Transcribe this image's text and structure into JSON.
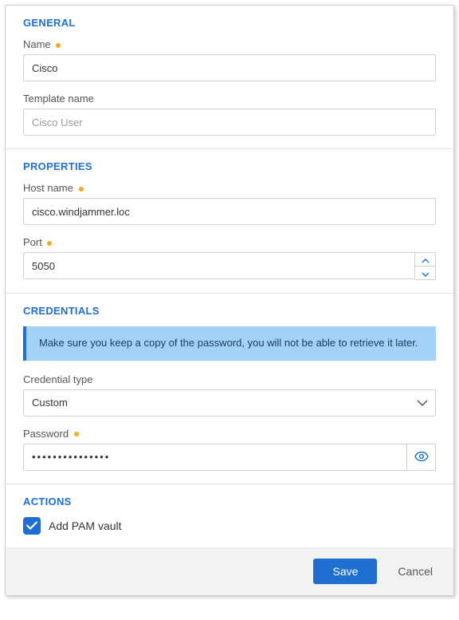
{
  "general": {
    "header": "GENERAL",
    "name_label": "Name",
    "name_value": "Cisco",
    "template_label": "Template name",
    "template_value": "Cisco User"
  },
  "properties": {
    "header": "PROPERTIES",
    "host_label": "Host name",
    "host_value": "cisco.windjammer.loc",
    "port_label": "Port",
    "port_value": "5050"
  },
  "credentials": {
    "header": "CREDENTIALS",
    "alert": "Make sure you keep a copy of the password, you will not be able to retrieve it later.",
    "type_label": "Credential type",
    "type_value": "Custom",
    "password_label": "Password",
    "password_value": "•••••••••••••••"
  },
  "actions": {
    "header": "ACTIONS",
    "pam_label": "Add PAM vault",
    "pam_checked": true
  },
  "footer": {
    "save": "Save",
    "cancel": "Cancel"
  },
  "colors": {
    "primary": "#1f6fd1",
    "alert_bg": "#a3d1f7",
    "required": "#f5a623"
  }
}
